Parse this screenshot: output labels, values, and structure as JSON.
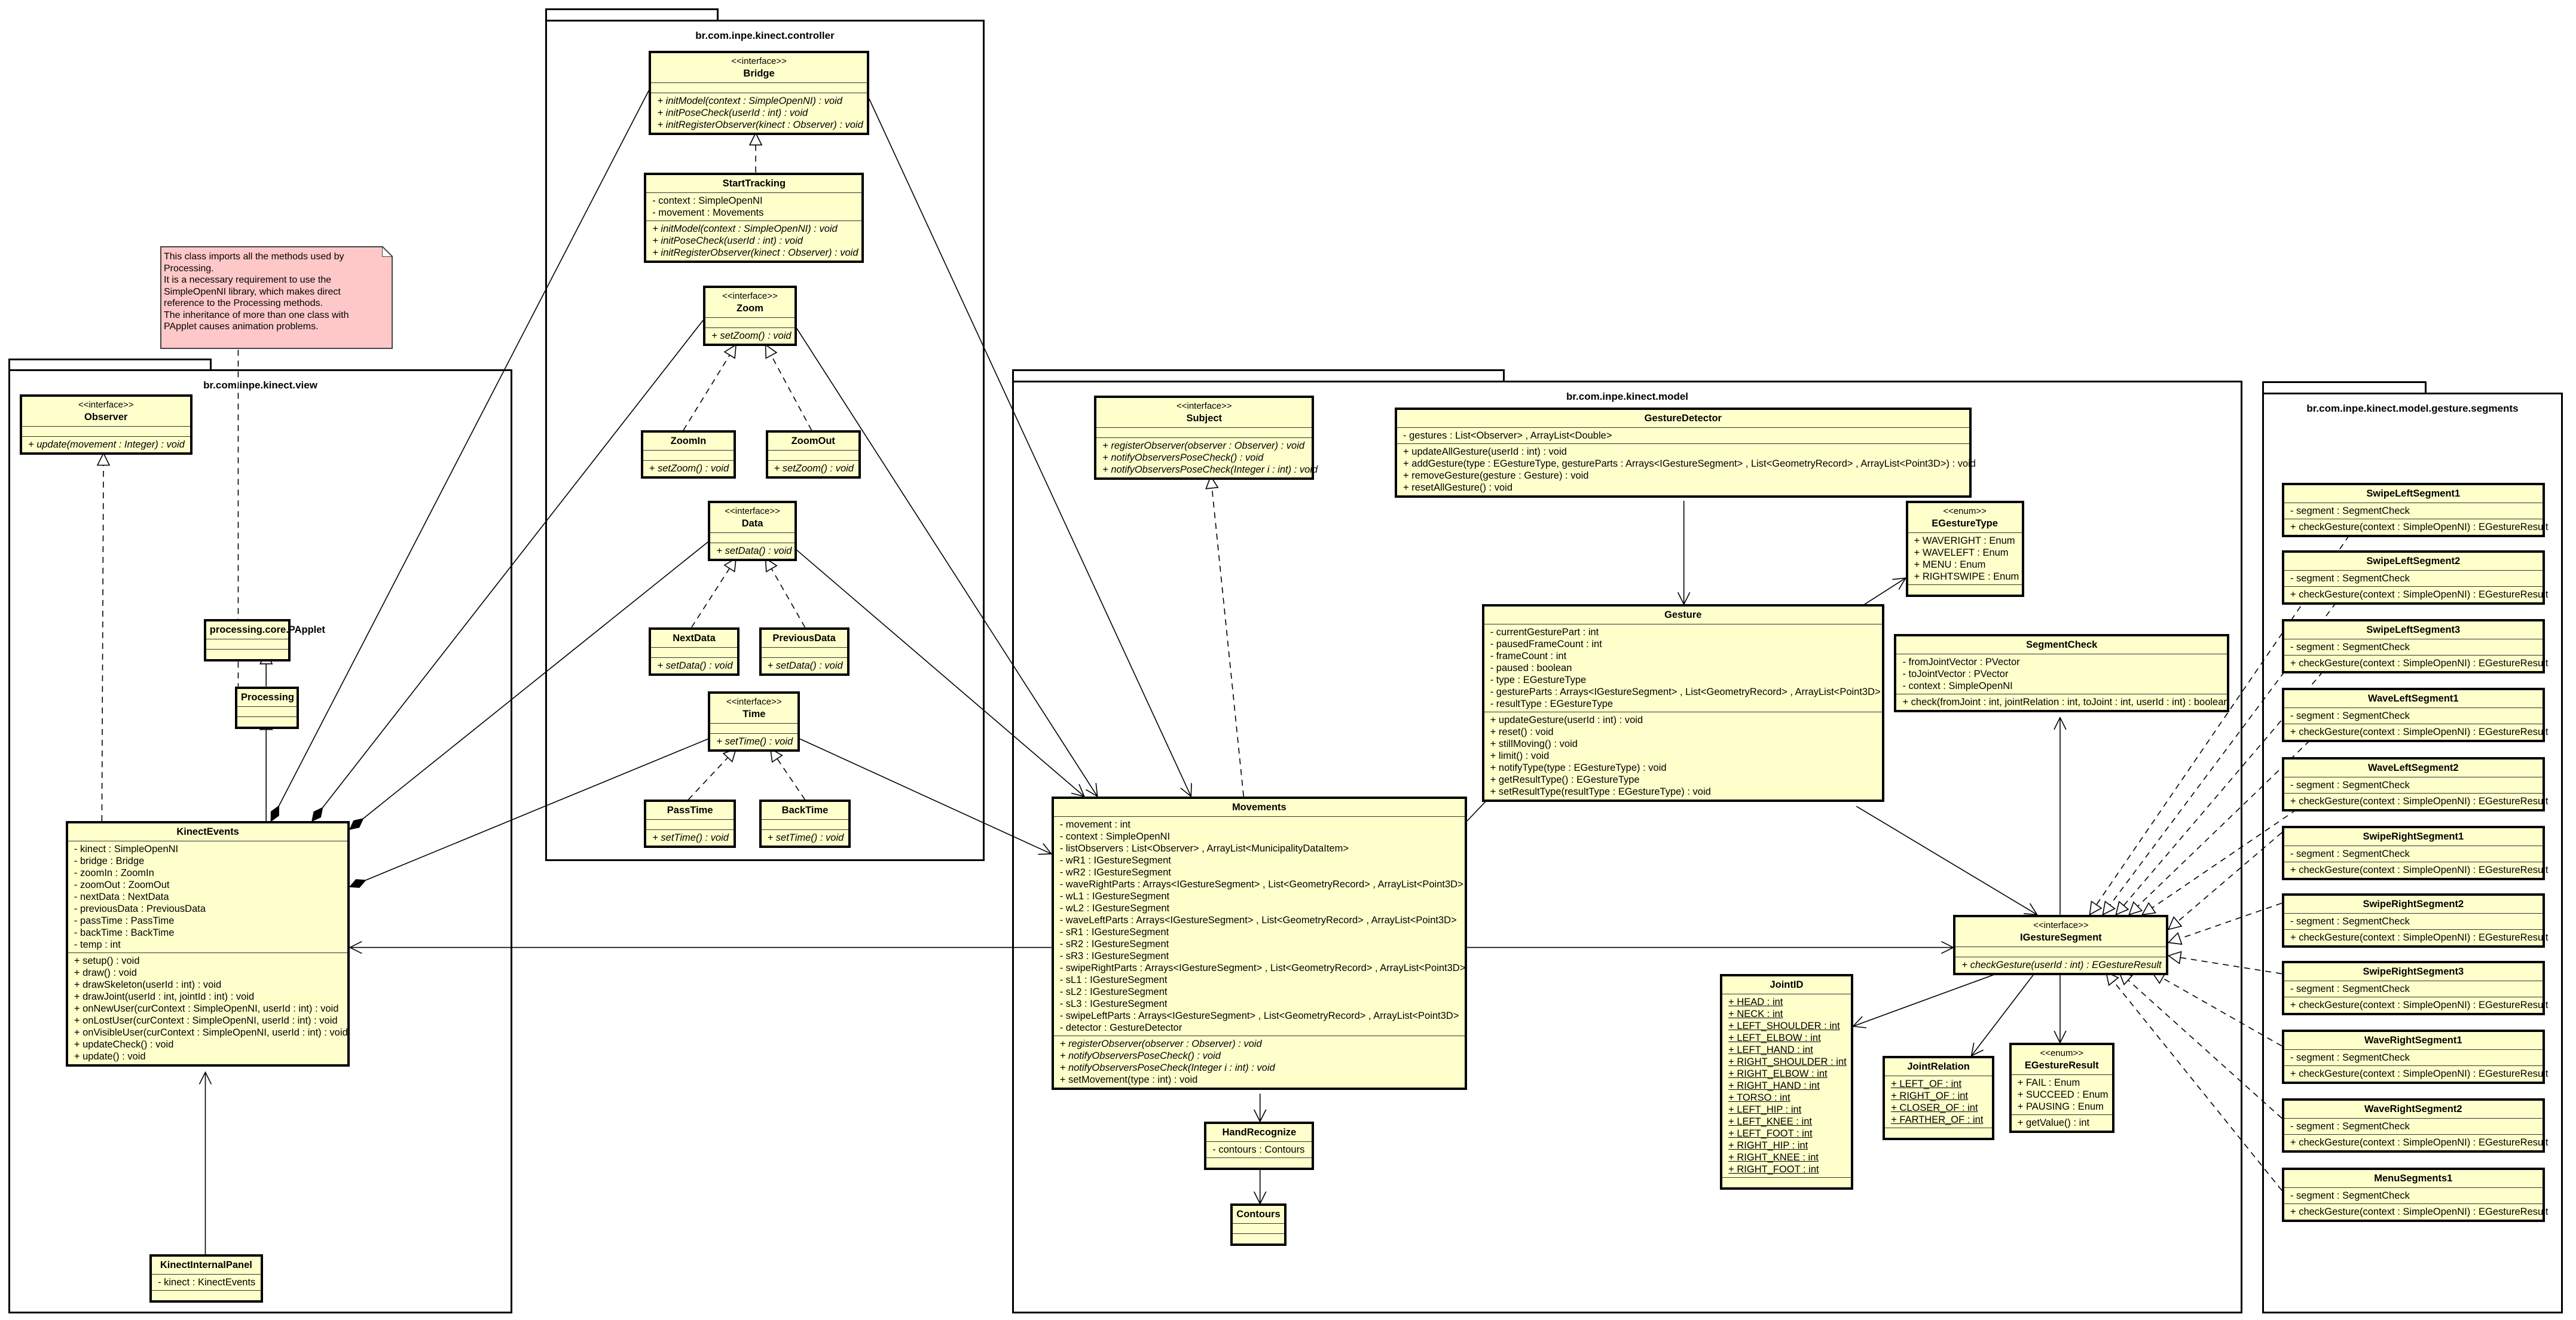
{
  "packages": {
    "controller": "br.com.inpe.kinect.controller",
    "view": "br.com.inpe.kinect.view",
    "model": "br.com.inpe.kinect.model",
    "segments": "br.com.inpe.kinect.model.gesture.segments"
  },
  "note": {
    "lines": [
      "This class imports all the methods used by",
      "Processing.",
      "It is a necessary requirement to use the",
      "SimpleOpenNI library, which makes direct",
      "reference to the  Processing methods.",
      "The inheritance of more than one class with",
      "PApplet causes  animation problems."
    ]
  },
  "colors": {
    "class_fill": "#ffffcc",
    "note_fill": "#ffc8c8",
    "border": "#000000"
  },
  "classes": [
    {
      "id": "Bridge",
      "stereotype": "<<interface>>",
      "name": "Bridge",
      "attributes": [],
      "operations": [
        "+ initModel(context : SimpleOpenNI) : void",
        "+ initPoseCheck(userId : int) : void",
        "+ initRegisterObserver(kinect : Observer) : void"
      ],
      "ops_italic": true
    },
    {
      "id": "StartTracking",
      "name": "StartTracking",
      "attributes": [
        "- context : SimpleOpenNI",
        "- movement : Movements"
      ],
      "operations": [
        "+ initModel(context : SimpleOpenNI) : void",
        "+ initPoseCheck(userId : int) : void",
        "+ initRegisterObserver(kinect : Observer) : void"
      ],
      "ops_italic": true
    },
    {
      "id": "Zoom",
      "stereotype": "<<interface>>",
      "name": "Zoom",
      "attributes": [],
      "operations": [
        "+ setZoom() : void"
      ],
      "ops_italic": true
    },
    {
      "id": "ZoomIn",
      "name": "ZoomIn",
      "attributes": [],
      "operations": [
        "+ setZoom() : void"
      ],
      "ops_italic": true
    },
    {
      "id": "ZoomOut",
      "name": "ZoomOut",
      "attributes": [],
      "operations": [
        "+ setZoom() : void"
      ],
      "ops_italic": true
    },
    {
      "id": "Data",
      "stereotype": "<<interface>>",
      "name": "Data",
      "attributes": [],
      "operations": [
        "+ setData() : void"
      ],
      "ops_italic": true
    },
    {
      "id": "NextData",
      "name": "NextData",
      "attributes": [],
      "operations": [
        "+ setData() : void"
      ],
      "ops_italic": true
    },
    {
      "id": "PreviousData",
      "name": "PreviousData",
      "attributes": [],
      "operations": [
        "+ setData() : void"
      ],
      "ops_italic": true
    },
    {
      "id": "Time",
      "stereotype": "<<interface>>",
      "name": "Time",
      "attributes": [],
      "operations": [
        "+ setTime() : void"
      ],
      "ops_italic": true
    },
    {
      "id": "PassTime",
      "name": "PassTime",
      "attributes": [],
      "operations": [
        "+ setTime() : void"
      ],
      "ops_italic": true
    },
    {
      "id": "BackTime",
      "name": "BackTime",
      "attributes": [],
      "operations": [
        "+ setTime() : void"
      ],
      "ops_italic": true
    },
    {
      "id": "Observer",
      "stereotype": "<<interface>>",
      "name": "Observer",
      "attributes": [],
      "operations": [
        "+ update(movement : Integer) : void"
      ],
      "ops_italic": true
    },
    {
      "id": "PApplet",
      "name": "processing.core.PApplet",
      "attributes": [],
      "operations": []
    },
    {
      "id": "Processing",
      "name": "Processing",
      "attributes": [],
      "operations": []
    },
    {
      "id": "KinectEvents",
      "name": "KinectEvents",
      "attributes": [
        "- kinect : SimpleOpenNI",
        "- bridge : Bridge",
        "- zoomIn : ZoomIn",
        "- zoomOut : ZoomOut",
        "- nextData : NextData",
        "- previousData : PreviousData",
        "- passTime : PassTime",
        "- backTime : BackTime",
        "- temp : int"
      ],
      "operations": [
        "+ setup() : void",
        "+ draw() : void",
        "+ drawSkeleton(userId : int) : void",
        "+ drawJoint(userId : int, jointId : int) : void",
        "+ onNewUser(curContext : SimpleOpenNI, userId : int) : void",
        "+ onLostUser(curContext : SimpleOpenNI, userId : int) : void",
        "+ onVisibleUser(curContext : SimpleOpenNI, userId : int) : void",
        "+ updateCheck() : void",
        "+ update() : void"
      ]
    },
    {
      "id": "KinectInternalPanel",
      "name": "KinectInternalPanel",
      "attributes": [
        "- kinect : KinectEvents"
      ],
      "operations": []
    },
    {
      "id": "Subject",
      "stereotype": "<<interface>>",
      "name": "Subject",
      "attributes": [],
      "operations": [
        "+ registerObserver(observer : Observer) : void",
        "+ notifyObserversPoseCheck() : void",
        "+ notifyObserversPoseCheck(Integer i : int) : void"
      ],
      "ops_italic": true
    },
    {
      "id": "GestureDetector",
      "name": "GestureDetector",
      "attributes": [
        "- gestures : List<Observer> , ArrayList<Double>"
      ],
      "operations": [
        "+ updateAllGesture(userId : int) : void",
        "+ addGesture(type : EGestureType, gestureParts : Arrays<IGestureSegment> , List<GeometryRecord> , ArrayList<Point3D>) : void",
        "+ removeGesture(gesture : Gesture) : void",
        "+ resetAllGesture() : void"
      ]
    },
    {
      "id": "EGestureType",
      "stereotype": "<<enum>>",
      "name": "EGestureType",
      "attributes": [
        "+ WAVERIGHT : Enum",
        "+ WAVELEFT : Enum",
        "+ MENU : Enum",
        "+ RIGHTSWIPE : Enum"
      ],
      "operations": []
    },
    {
      "id": "Gesture",
      "name": "Gesture",
      "attributes": [
        "- currentGesturePart : int",
        "- pausedFrameCount : int",
        "- frameCount : int",
        "- paused : boolean",
        "- type : EGestureType",
        "- gestureParts : Arrays<IGestureSegment> , List<GeometryRecord> , ArrayList<Point3D>",
        "- resultType : EGestureType"
      ],
      "operations": [
        "+ updateGesture(userId : int) : void",
        "+ reset() : void",
        "+ stillMoving() : void",
        "+ limit() : void",
        "+ notifyType(type : EGestureType) : void",
        "+ getResultType() : EGestureType",
        "+ setResultType(resultType : EGestureType) : void"
      ]
    },
    {
      "id": "SegmentCheck",
      "name": "SegmentCheck",
      "attributes": [
        "- fromJointVector : PVector",
        "- toJointVector : PVector",
        "- context : SimpleOpenNI"
      ],
      "operations": [
        "+ check(fromJoint : int, jointRelation : int, toJoint : int, userId : int) : boolean"
      ]
    },
    {
      "id": "Movements",
      "name": "Movements",
      "attributes": [
        "- movement : int",
        "- context : SimpleOpenNI",
        "- listObservers : List<Observer> , ArrayList<MunicipalityDataItem>",
        "- wR1 : IGestureSegment",
        "- wR2 : IGestureSegment",
        "- waveRightParts : Arrays<IGestureSegment> , List<GeometryRecord> , ArrayList<Point3D>",
        "- wL1 : IGestureSegment",
        "- wL2 : IGestureSegment",
        "- waveLeftParts : Arrays<IGestureSegment> , List<GeometryRecord> , ArrayList<Point3D>",
        "- sR1 : IGestureSegment",
        "- sR2 : IGestureSegment",
        "- sR3 : IGestureSegment",
        "- swipeRightParts : Arrays<IGestureSegment> , List<GeometryRecord> , ArrayList<Point3D>",
        "- sL1 : IGestureSegment",
        "- sL2 : IGestureSegment",
        "- sL3 : IGestureSegment",
        "- swipeLeftParts : Arrays<IGestureSegment> , List<GeometryRecord> , ArrayList<Point3D>",
        "- detector : GestureDetector"
      ],
      "operations": [
        "+ registerObserver(observer : Observer) : void",
        "+ notifyObserversPoseCheck() : void",
        "+ notifyObserversPoseCheck(Integer i : int) : void",
        "+ setMovement(type : int) : void"
      ],
      "italic_ops_count": 3
    },
    {
      "id": "HandRecognize",
      "name": "HandRecognize",
      "attributes": [
        "- contours : Contours"
      ],
      "operations": []
    },
    {
      "id": "Contours",
      "name": "Contours",
      "attributes": [],
      "operations": []
    },
    {
      "id": "IGestureSegment",
      "stereotype": "<<interface>>",
      "name": "IGestureSegment",
      "attributes": [],
      "operations": [
        "+ checkGesture(userId : int) : EGestureResult"
      ],
      "ops_italic": true
    },
    {
      "id": "JointID",
      "name": "JointID",
      "attributes": [
        "+ HEAD : int",
        "+ NECK : int",
        "+ LEFT_SHOULDER : int",
        "+ LEFT_ELBOW : int",
        "+ LEFT_HAND : int",
        "+ RIGHT_SHOULDER : int",
        "+ RIGHT_ELBOW : int",
        "+ RIGHT_HAND : int",
        "+ TORSO : int",
        "+ LEFT_HIP : int",
        "+ LEFT_KNEE : int",
        "+ LEFT_FOOT : int",
        "+ RIGHT_HIP : int",
        "+ RIGHT_KNEE : int",
        "+ RIGHT_FOOT : int"
      ],
      "operations": [],
      "attrs_static": true
    },
    {
      "id": "JointRelation",
      "name": "JointRelation",
      "attributes": [
        "+ LEFT_OF : int",
        "+ RIGHT_OF : int",
        "+ CLOSER_OF : int",
        "+ FARTHER_OF : int"
      ],
      "operations": [],
      "attrs_static": true
    },
    {
      "id": "EGestureResult",
      "stereotype": "<<enum>>",
      "name": "EGestureResult",
      "attributes": [
        "+ FAIL : Enum",
        "+ SUCCEED : Enum",
        "+ PAUSING : Enum"
      ],
      "operations": [
        "+ getValue() : int"
      ]
    },
    {
      "id": "SwipeLeftSegment1",
      "name": "SwipeLeftSegment1",
      "attributes": [
        "- segment : SegmentCheck"
      ],
      "operations": [
        "+ checkGesture(context : SimpleOpenNI) : EGestureResult"
      ]
    },
    {
      "id": "SwipeLeftSegment2",
      "name": "SwipeLeftSegment2",
      "attributes": [
        "- segment : SegmentCheck"
      ],
      "operations": [
        "+ checkGesture(context : SimpleOpenNI) : EGestureResult"
      ]
    },
    {
      "id": "SwipeLeftSegment3",
      "name": "SwipeLeftSegment3",
      "attributes": [
        "- segment : SegmentCheck"
      ],
      "operations": [
        "+ checkGesture(context : SimpleOpenNI) : EGestureResult"
      ]
    },
    {
      "id": "WaveLeftSegment1",
      "name": "WaveLeftSegment1",
      "attributes": [
        "- segment : SegmentCheck"
      ],
      "operations": [
        "+ checkGesture(context : SimpleOpenNI) : EGestureResult"
      ]
    },
    {
      "id": "WaveLeftSegment2",
      "name": "WaveLeftSegment2",
      "attributes": [
        "- segment : SegmentCheck"
      ],
      "operations": [
        "+ checkGesture(context : SimpleOpenNI) : EGestureResult"
      ]
    },
    {
      "id": "SwipeRightSegment1",
      "name": "SwipeRightSegment1",
      "attributes": [
        "- segment : SegmentCheck"
      ],
      "operations": [
        "+ checkGesture(context : SimpleOpenNI) : EGestureResult"
      ]
    },
    {
      "id": "SwipeRightSegment2",
      "name": "SwipeRightSegment2",
      "attributes": [
        "- segment : SegmentCheck"
      ],
      "operations": [
        "+ checkGesture(context : SimpleOpenNI) : EGestureResult"
      ]
    },
    {
      "id": "SwipeRightSegment3",
      "name": "SwipeRightSegment3",
      "attributes": [
        "- segment : SegmentCheck"
      ],
      "operations": [
        "+ checkGesture(context : SimpleOpenNI) : EGestureResult"
      ]
    },
    {
      "id": "WaveRightSegment1",
      "name": "WaveRightSegment1",
      "attributes": [
        "- segment : SegmentCheck"
      ],
      "operations": [
        "+ checkGesture(context : SimpleOpenNI) : EGestureResult"
      ]
    },
    {
      "id": "WaveRightSegment2",
      "name": "WaveRightSegment2",
      "attributes": [
        "- segment : SegmentCheck"
      ],
      "operations": [
        "+ checkGesture(context : SimpleOpenNI) : EGestureResult"
      ]
    },
    {
      "id": "MenuSegments1",
      "name": "MenuSegments1",
      "attributes": [
        "- segment : SegmentCheck"
      ],
      "operations": [
        "+ checkGesture(context : SimpleOpenNI) : EGestureResult"
      ]
    }
  ]
}
